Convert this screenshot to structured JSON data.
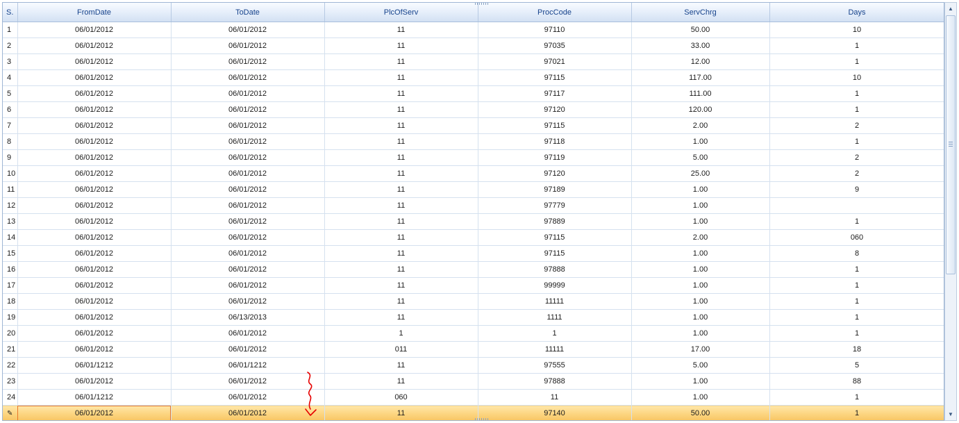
{
  "columns": [
    "S.",
    "FromDate",
    "ToDate",
    "PlcOfServ",
    "ProcCode",
    "ServChrg",
    "Days"
  ],
  "rows": [
    [
      "1",
      "06/01/2012",
      "06/01/2012",
      "11",
      "97110",
      "50.00",
      "10"
    ],
    [
      "2",
      "06/01/2012",
      "06/01/2012",
      "11",
      "97035",
      "33.00",
      "1"
    ],
    [
      "3",
      "06/01/2012",
      "06/01/2012",
      "11",
      "97021",
      "12.00",
      "1"
    ],
    [
      "4",
      "06/01/2012",
      "06/01/2012",
      "11",
      "97115",
      "117.00",
      "10"
    ],
    [
      "5",
      "06/01/2012",
      "06/01/2012",
      "11",
      "97117",
      "111.00",
      "1"
    ],
    [
      "6",
      "06/01/2012",
      "06/01/2012",
      "11",
      "97120",
      "120.00",
      "1"
    ],
    [
      "7",
      "06/01/2012",
      "06/01/2012",
      "11",
      "97115",
      "2.00",
      "2"
    ],
    [
      "8",
      "06/01/2012",
      "06/01/2012",
      "11",
      "97118",
      "1.00",
      "1"
    ],
    [
      "9",
      "06/01/2012",
      "06/01/2012",
      "11",
      "97119",
      "5.00",
      "2"
    ],
    [
      "10",
      "06/01/2012",
      "06/01/2012",
      "11",
      "97120",
      "25.00",
      "2"
    ],
    [
      "11",
      "06/01/2012",
      "06/01/2012",
      "11",
      "97189",
      "1.00",
      "9"
    ],
    [
      "12",
      "06/01/2012",
      "06/01/2012",
      "11",
      "97779",
      "1.00",
      ""
    ],
    [
      "13",
      "06/01/2012",
      "06/01/2012",
      "11",
      "97889",
      "1.00",
      "1"
    ],
    [
      "14",
      "06/01/2012",
      "06/01/2012",
      "11",
      "97115",
      "2.00",
      "060"
    ],
    [
      "15",
      "06/01/2012",
      "06/01/2012",
      "11",
      "97115",
      "1.00",
      "8"
    ],
    [
      "16",
      "06/01/2012",
      "06/01/2012",
      "11",
      "97888",
      "1.00",
      "1"
    ],
    [
      "17",
      "06/01/2012",
      "06/01/2012",
      "11",
      "99999",
      "1.00",
      "1"
    ],
    [
      "18",
      "06/01/2012",
      "06/01/2012",
      "11",
      "11111",
      "1.00",
      "1"
    ],
    [
      "19",
      "06/01/2012",
      "06/13/2013",
      "11",
      "1111",
      "1.00",
      "1"
    ],
    [
      "20",
      "06/01/2012",
      "06/01/2012",
      "1",
      "1",
      "1.00",
      "1"
    ],
    [
      "21",
      "06/01/2012",
      "06/01/2012",
      "011",
      "11111",
      "17.00",
      "18"
    ],
    [
      "22",
      "06/01/1212",
      "06/01/1212",
      "11",
      "97555",
      "5.00",
      "5"
    ],
    [
      "23",
      "06/01/2012",
      "06/01/2012",
      "11",
      "97888",
      "1.00",
      "88"
    ],
    [
      "24",
      "06/01/1212",
      "06/01/2012",
      "060",
      "11",
      "1.00",
      "1"
    ]
  ],
  "selected_row": [
    "",
    "06/01/2012",
    "06/01/2012",
    "11",
    "97140",
    "50.00",
    "1"
  ],
  "selected_row_indicator_icon": "current-row-pencil-icon",
  "scrollbar": {
    "up_arrow": "▲",
    "down_arrow": "▼"
  },
  "colors": {
    "header_text": "#15428b",
    "selected_row": "#fcd47f",
    "focus_cell_border": "#e8772a",
    "annotation": "#e60000"
  }
}
